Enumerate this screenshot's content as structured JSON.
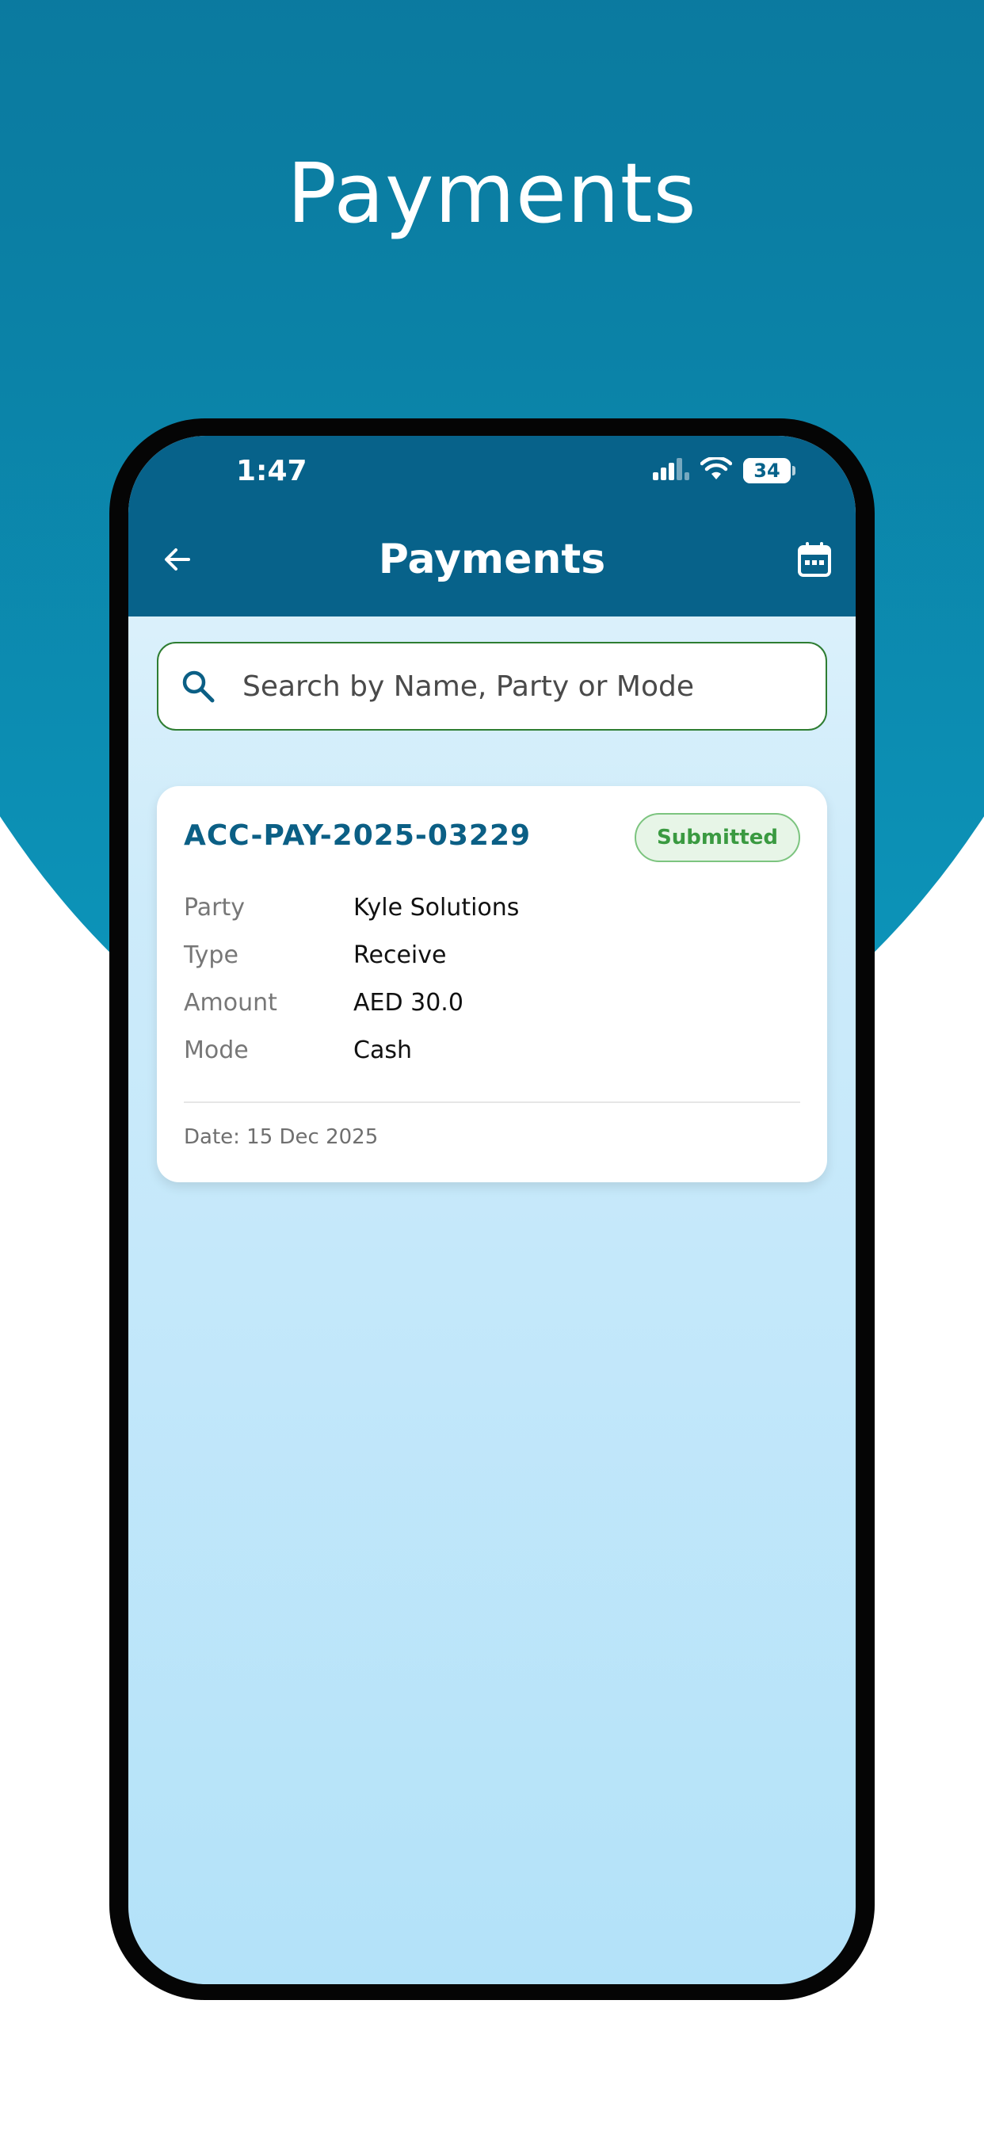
{
  "promo": {
    "title": "Payments"
  },
  "status_bar": {
    "time": "1:47",
    "battery": "34",
    "battery_level_percent": 34
  },
  "header": {
    "title": "Payments",
    "back_icon": "arrow-left-icon",
    "calendar_icon": "calendar-icon"
  },
  "search": {
    "placeholder": "Search by Name, Party or Mode",
    "value": ""
  },
  "payments": [
    {
      "id": "ACC-PAY-2025-03229",
      "status": "Submitted",
      "fields": [
        {
          "label": "Party",
          "value": "Kyle Solutions"
        },
        {
          "label": "Type",
          "value": "Receive"
        },
        {
          "label": "Amount",
          "value": "AED 30.0"
        },
        {
          "label": "Mode",
          "value": "Cash"
        }
      ],
      "date": "Date: 15 Dec 2025"
    }
  ],
  "colors": {
    "primary": "#07628a",
    "accent_green": "#2e7d32",
    "status_green": "#3a9a41",
    "id_blue": "#0b5f85"
  }
}
